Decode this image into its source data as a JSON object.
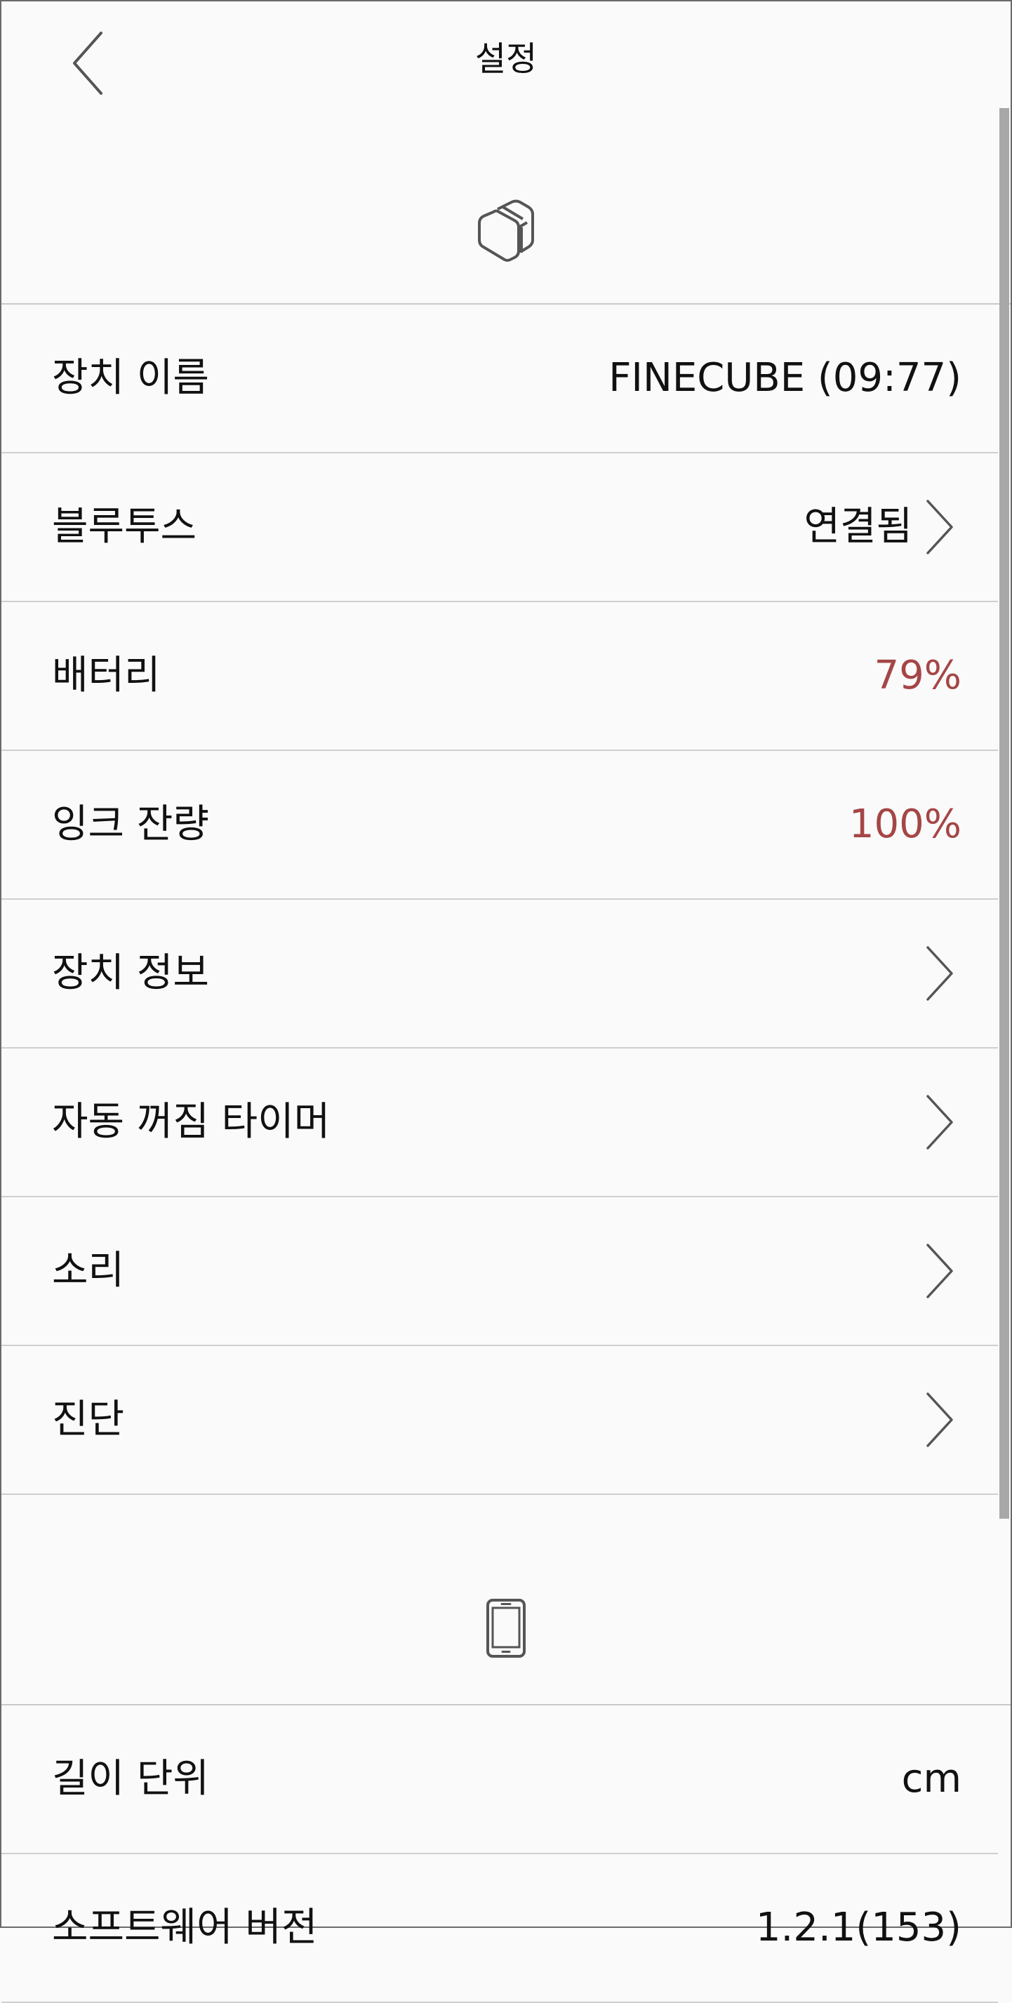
{
  "header": {
    "title": "설정",
    "back_icon": "chevron-left-icon"
  },
  "device_section": {
    "icon": "printer-cube-icon",
    "rows": [
      {
        "label": "장치 이름",
        "value": "FINECUBE (09:77)"
      },
      {
        "label": "블루투스",
        "value": "연결됨",
        "chevron": true
      },
      {
        "label": "배터리",
        "value": "79%",
        "value_color": "#a54646"
      },
      {
        "label": "잉크 잔량",
        "value": "100%",
        "value_color": "#a54646"
      },
      {
        "label": "장치 정보",
        "chevron": true
      },
      {
        "label": "자동 꺼짐 타이머",
        "chevron": true
      },
      {
        "label": "소리",
        "chevron": true
      },
      {
        "label": "진단",
        "chevron": true
      }
    ]
  },
  "app_section": {
    "icon": "smartphone-icon",
    "rows": [
      {
        "label": "길이 단위",
        "value": "cm"
      },
      {
        "label": "소프트웨어 버전",
        "value": "1.2.1(153)"
      }
    ]
  },
  "colors": {
    "accent_red": "#a54646",
    "background": "#fafafa",
    "divider": "#cfcfcf"
  }
}
